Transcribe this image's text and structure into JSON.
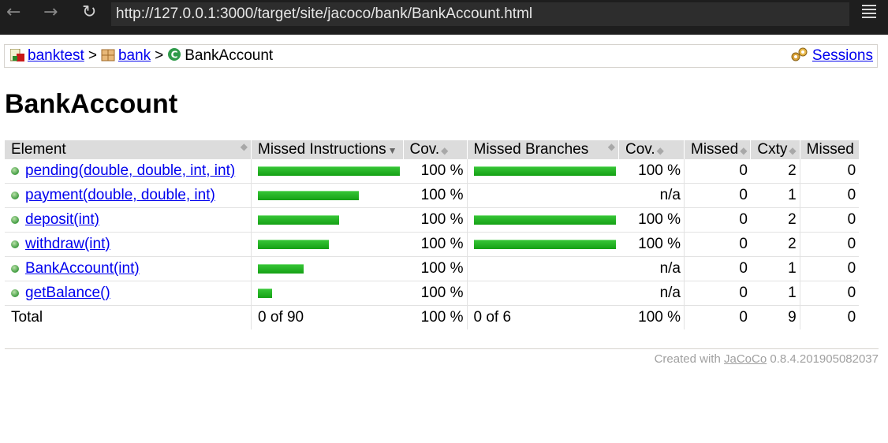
{
  "browser": {
    "back_glyph": "←",
    "forward_glyph": "→",
    "reload_glyph": "↻",
    "url": "http://127.0.0.1:3000/target/site/jacoco/bank/BankAccount.html"
  },
  "breadcrumb": {
    "items": [
      {
        "label": "banktest",
        "icon": "report-icon"
      },
      {
        "label": "bank",
        "icon": "package-icon"
      }
    ],
    "separator": ">",
    "current": "BankAccount",
    "current_icon": "class-icon",
    "sessions_label": "Sessions",
    "sessions_icon": "gears-icon"
  },
  "page_title": "BankAccount",
  "table": {
    "headers": [
      "Element",
      "Missed Instructions",
      "Cov.",
      "Missed Branches",
      "Cov.",
      "Missed",
      "Cxty",
      "Missed"
    ],
    "rows": [
      {
        "element": "pending(double, double, int, int)",
        "instr_fraction": 1.0,
        "instr_cov": "100 %",
        "branch_fraction": 1.0,
        "branch_cov": "100 %",
        "missed_cxty": "0",
        "cxty": "2",
        "missed": "0"
      },
      {
        "element": "payment(double, double, int)",
        "instr_fraction": 0.71,
        "instr_cov": "100 %",
        "branch_fraction": null,
        "branch_cov": "n/a",
        "missed_cxty": "0",
        "cxty": "1",
        "missed": "0"
      },
      {
        "element": "deposit(int)",
        "instr_fraction": 0.57,
        "instr_cov": "100 %",
        "branch_fraction": 1.0,
        "branch_cov": "100 %",
        "missed_cxty": "0",
        "cxty": "2",
        "missed": "0"
      },
      {
        "element": "withdraw(int)",
        "instr_fraction": 0.5,
        "instr_cov": "100 %",
        "branch_fraction": 1.0,
        "branch_cov": "100 %",
        "missed_cxty": "0",
        "cxty": "2",
        "missed": "0"
      },
      {
        "element": "BankAccount(int)",
        "instr_fraction": 0.32,
        "instr_cov": "100 %",
        "branch_fraction": null,
        "branch_cov": "n/a",
        "missed_cxty": "0",
        "cxty": "1",
        "missed": "0"
      },
      {
        "element": "getBalance()",
        "instr_fraction": 0.1,
        "instr_cov": "100 %",
        "branch_fraction": null,
        "branch_cov": "n/a",
        "missed_cxty": "0",
        "cxty": "1",
        "missed": "0"
      }
    ],
    "total": {
      "label": "Total",
      "instr": "0 of 90",
      "instr_cov": "100 %",
      "branch": "0 of 6",
      "branch_cov": "100 %",
      "missed_cxty": "0",
      "cxty": "9",
      "missed": "0"
    }
  },
  "footer": {
    "prefix": "Created with",
    "link": "JaCoCo",
    "version": "0.8.4.201905082037"
  },
  "colors": {
    "bar_green": "#22b022",
    "link": "#0000ee",
    "header_bg": "#dcdcdc"
  }
}
